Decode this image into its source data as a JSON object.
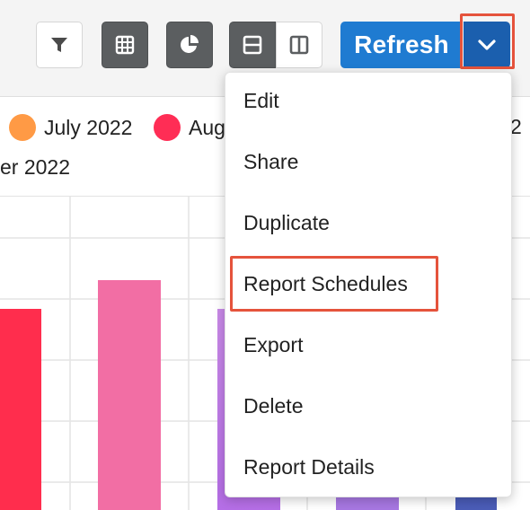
{
  "toolbar": {
    "buttons": [
      {
        "icon": "filter-icon"
      },
      {
        "icon": "grid-icon"
      },
      {
        "icon": "pie-chart-icon"
      },
      {
        "icon": "split-rows-icon"
      },
      {
        "icon": "split-columns-icon"
      }
    ],
    "refresh_label": "Refresh",
    "caret_icon": "chevron-down-icon"
  },
  "legend": {
    "items": [
      {
        "label": "July 2022",
        "color": "#ff9a45"
      },
      {
        "label": "Aug",
        "color": "#ff2d55"
      },
      {
        "label": "2",
        "color": ""
      },
      {
        "label": "er 2022",
        "color": ""
      }
    ]
  },
  "menu": {
    "items": [
      {
        "label": "Edit"
      },
      {
        "label": "Share"
      },
      {
        "label": "Duplicate"
      },
      {
        "label": "Report Schedules"
      },
      {
        "label": "Export"
      },
      {
        "label": "Delete"
      },
      {
        "label": "Report Details"
      }
    ]
  },
  "colors": {
    "accent_blue": "#1f7bd1",
    "accent_blue_dark": "#1b5fae",
    "highlight_red": "#e5533c",
    "bar_red": "#ff2d4d",
    "bar_pink": "#f26ea4",
    "bar_violet": "#c078e8",
    "bar_navy": "#3d4fa8"
  }
}
